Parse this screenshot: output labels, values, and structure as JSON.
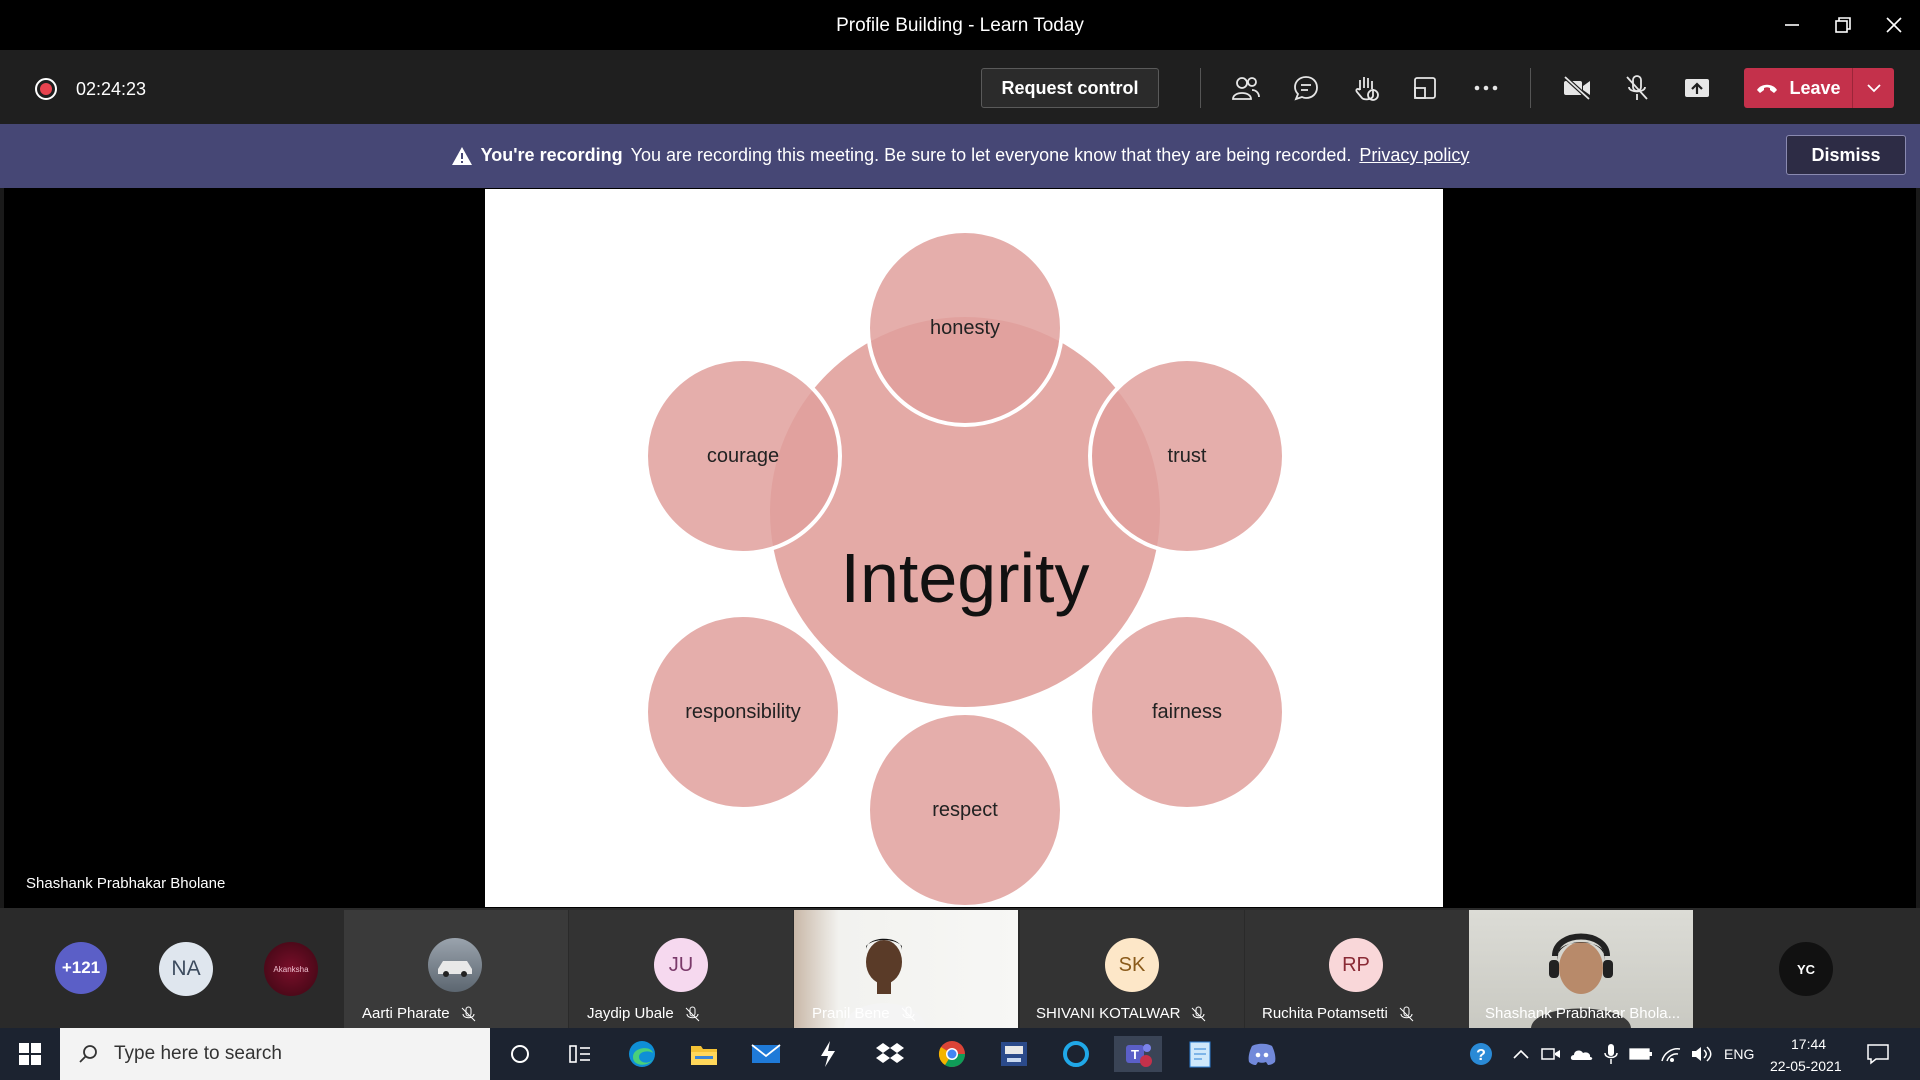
{
  "window": {
    "title": "Profile Building - Learn Today"
  },
  "toolbar": {
    "timer": "02:24:23",
    "request_control_label": "Request control",
    "leave_label": "Leave"
  },
  "banner": {
    "heading": "You're recording",
    "message": "You are recording this meeting. Be sure to let everyone know that they are being recorded.",
    "privacy_link": "Privacy policy",
    "dismiss_label": "Dismiss"
  },
  "stage": {
    "presenter_name": "Shashank Prabhakar Bholane",
    "slide": {
      "center": "Integrity",
      "petals": [
        "honesty",
        "trust",
        "fairness",
        "respect",
        "responsibility",
        "courage"
      ],
      "petal_color": "#e0a09c",
      "center_color": "#e4aaa6"
    }
  },
  "participants": {
    "overflow": "+121",
    "na_initials": "NA",
    "tiles": [
      {
        "name": "Aarti Pharate"
      },
      {
        "name": "Jaydip Ubale",
        "initials": "JU"
      },
      {
        "name": "Pranil Bene"
      },
      {
        "name": "SHIVANI KOTALWAR",
        "initials": "SK"
      },
      {
        "name": "Ruchita Potamsetti",
        "initials": "RP"
      },
      {
        "name": "Shashank Prabhakar Bhola..."
      }
    ],
    "yc_initials": "YC",
    "akanksha_label": "Akanksha"
  },
  "taskbar": {
    "search_placeholder": "Type here to search",
    "language": "ENG",
    "time": "17:44",
    "date": "22-05-2021"
  },
  "colors": {
    "accent_record": "#e8434f",
    "leave": "#c4314b",
    "banner": "#464775"
  }
}
